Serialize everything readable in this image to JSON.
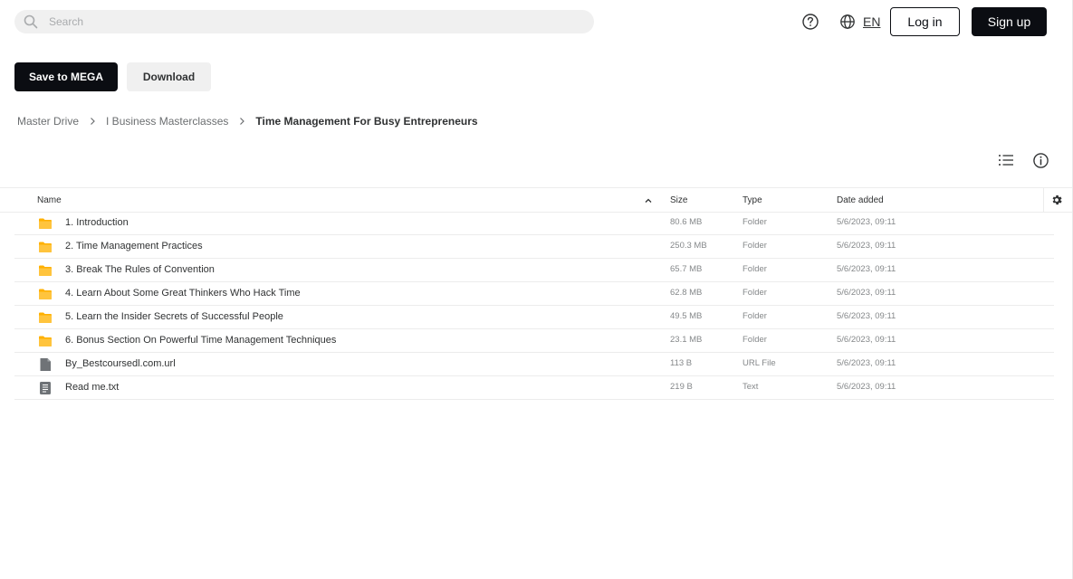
{
  "header": {
    "search_placeholder": "Search",
    "language": "EN",
    "login_label": "Log in",
    "signup_label": "Sign up"
  },
  "actions": {
    "save_label": "Save to MEGA",
    "download_label": "Download"
  },
  "breadcrumb": [
    "Master Drive",
    "I Business Masterclasses",
    "Time Management For Busy Entrepreneurs"
  ],
  "table": {
    "columns": {
      "name": "Name",
      "size": "Size",
      "type": "Type",
      "date": "Date added"
    },
    "rows": [
      {
        "name": "1. Introduction",
        "size": "80.6 MB",
        "type": "Folder",
        "date": "5/6/2023, 09:11",
        "icon": "folder-icon"
      },
      {
        "name": "2. Time Management Practices",
        "size": "250.3 MB",
        "type": "Folder",
        "date": "5/6/2023, 09:11",
        "icon": "folder-icon"
      },
      {
        "name": "3. Break The Rules of Convention",
        "size": "65.7 MB",
        "type": "Folder",
        "date": "5/6/2023, 09:11",
        "icon": "folder-icon"
      },
      {
        "name": "4. Learn About Some Great Thinkers Who Hack Time",
        "size": "62.8 MB",
        "type": "Folder",
        "date": "5/6/2023, 09:11",
        "icon": "folder-icon"
      },
      {
        "name": "5. Learn the Insider Secrets of Successful People",
        "size": "49.5 MB",
        "type": "Folder",
        "date": "5/6/2023, 09:11",
        "icon": "folder-icon"
      },
      {
        "name": "6. Bonus Section On Powerful Time Management Techniques",
        "size": "23.1 MB",
        "type": "Folder",
        "date": "5/6/2023, 09:11",
        "icon": "folder-icon"
      },
      {
        "name": "By_Bestcoursedl.com.url",
        "size": "113 B",
        "type": "URL File",
        "date": "5/6/2023, 09:11",
        "icon": "generic-file-icon"
      },
      {
        "name": "Read me.txt",
        "size": "219 B",
        "type": "Text",
        "date": "5/6/2023, 09:11",
        "icon": "text-file-icon"
      }
    ]
  },
  "colors": {
    "primary": "#0b0d12",
    "folder": "#ffb000",
    "muted_text": "#85888a",
    "divider": "#ececec"
  }
}
